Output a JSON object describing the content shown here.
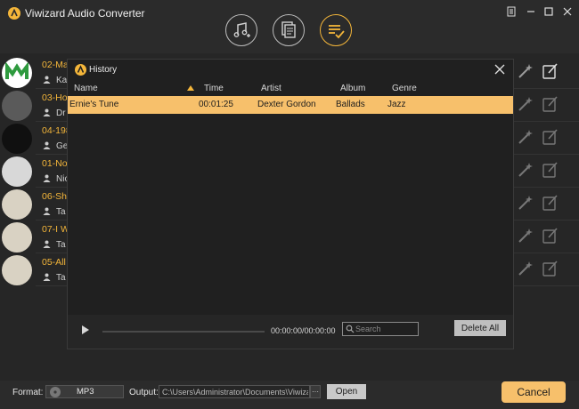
{
  "app": {
    "title": "Viwizard Audio Converter"
  },
  "colors": {
    "accent": "#f4b63a",
    "highlight_row": "#f7c06b",
    "background": "#2b2b2b"
  },
  "toolbar": {
    "buttons": [
      {
        "icon": "add-music-icon",
        "active": false
      },
      {
        "icon": "add-files-icon",
        "active": false
      },
      {
        "icon": "history-list-icon",
        "active": true
      }
    ]
  },
  "songs": [
    {
      "name": "02-Ma",
      "artist": "Kai"
    },
    {
      "name": "03-Ho",
      "artist": "Dr"
    },
    {
      "name": "04-198",
      "artist": "Ge"
    },
    {
      "name": "01-Not",
      "artist": "Nic"
    },
    {
      "name": "06-Sha",
      "artist": "Ta"
    },
    {
      "name": "07-I W",
      "artist": "Ta"
    },
    {
      "name": "05-All",
      "artist": "Ta"
    }
  ],
  "history": {
    "title": "History",
    "columns": {
      "name": "Name",
      "time": "Time",
      "artist": "Artist",
      "album": "Album",
      "genre": "Genre"
    },
    "rows": [
      {
        "name": "Ernie's Tune",
        "time": "00:01:25",
        "artist": "Dexter Gordon",
        "album": "Ballads",
        "genre": "Jazz"
      }
    ],
    "player": {
      "time": "00:00:00/00:00:00"
    },
    "search": {
      "placeholder": "Search",
      "value": ""
    },
    "delete_all_label": "Delete All"
  },
  "bottom": {
    "format_label": "Format:",
    "format_value": "MP3",
    "output_label": "Output:",
    "output_path": "C:\\Users\\Administrator\\Documents\\Viwizard Au",
    "browse_label": "···",
    "open_label": "Open",
    "cancel_label": "Cancel"
  }
}
